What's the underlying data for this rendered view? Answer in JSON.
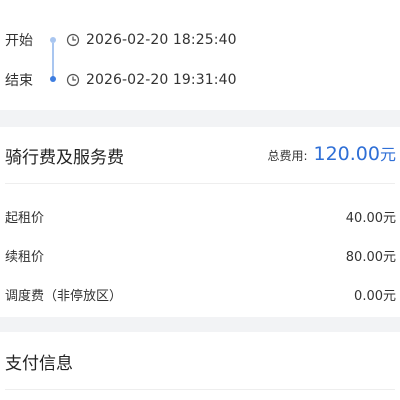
{
  "trip": {
    "start_label": "开始",
    "start_time": "2026-02-20 18:25:40",
    "end_label": "结束",
    "end_time": "2026-02-20 19:31:40"
  },
  "fees": {
    "title": "骑行费及服务费",
    "total_label": "总费用:",
    "total_amount": "120.00",
    "total_unit": "元",
    "items": [
      {
        "name": "起租价",
        "value": "40.00元"
      },
      {
        "name": "续租价",
        "value": "80.00元"
      },
      {
        "name": "调度费（非停放区）",
        "value": "0.00元"
      }
    ]
  },
  "payment": {
    "title": "支付信息"
  },
  "colors": {
    "accent": "#2f6fd6",
    "timeline_light": "#a9c6f0",
    "timeline_dark": "#3d7de0",
    "background": "#f2f3f5"
  },
  "icons": {
    "clock": "clock-icon"
  }
}
